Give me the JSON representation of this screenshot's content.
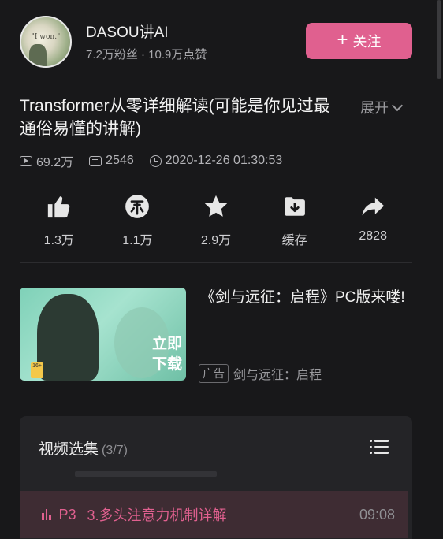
{
  "uploader": {
    "avatar_caption": "\"I won.\"",
    "name": "DASOU讲AI",
    "stats": "7.2万粉丝 · 10.9万点赞",
    "follow_label": "关注"
  },
  "video": {
    "title": "Transformer从零详细解读(可能是你见过最通俗易懂的讲解)",
    "expand_label": "展开",
    "views": "69.2万",
    "danmaku": "2546",
    "published": "2020-12-26 01:30:53"
  },
  "actions": [
    {
      "icon": "like-icon",
      "label": "1.3万"
    },
    {
      "icon": "coin-icon",
      "label": "1.1万"
    },
    {
      "icon": "star-icon",
      "label": "2.9万"
    },
    {
      "icon": "download-icon",
      "label": "缓存"
    },
    {
      "icon": "share-icon",
      "label": "2828"
    }
  ],
  "ad": {
    "title": "《剑与远征：启程》PC版来喽!",
    "tag": "广告",
    "advertiser": "剑与远征：启程",
    "thumb_cta": "立即下载",
    "thumb_age": "16+"
  },
  "collection": {
    "title": "视频选集",
    "count": "(3/7)",
    "current": {
      "code": "P3",
      "title": "3.多头注意力机制详解",
      "duration": "09:08"
    }
  },
  "colors": {
    "accent": "#e0608f",
    "background": "#18181a",
    "panel": "#242427"
  }
}
